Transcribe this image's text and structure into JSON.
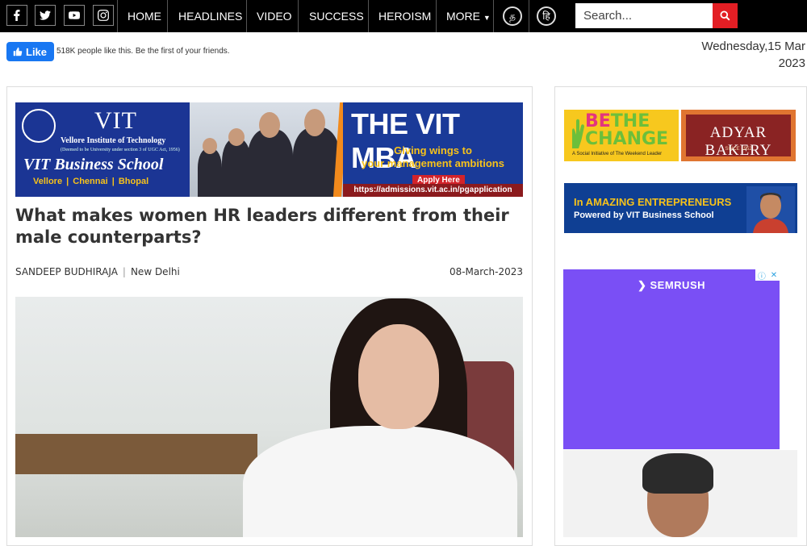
{
  "nav": {
    "social": [
      "facebook-icon",
      "twitter-icon",
      "youtube-icon",
      "instagram-icon"
    ],
    "items": [
      "HOME",
      "HEADLINES",
      "VIDEO",
      "SUCCESS",
      "HEROISM",
      "MORE"
    ],
    "lang_tamil": "த",
    "lang_hindi": "हि",
    "search_placeholder": "Search..."
  },
  "likebar": {
    "button": "Like",
    "text": "518K people like this. Be the first of your friends."
  },
  "date": {
    "line1": "Wednesday,15 Mar",
    "line2": "2023"
  },
  "banner": {
    "vit": "VIT",
    "institute": "Vellore Institute of Technology",
    "deemed": "(Deemed to be University under section 3 of UGC Act, 1956)",
    "school": "VIT Business School",
    "cities": "Vellore | Chennai | Bhopal",
    "mba": "THE VIT MBA",
    "tagline1": "Giving wings to",
    "tagline2": "your management ambitions",
    "apply": "Apply Here",
    "url": "https://admissions.vit.ac.in/pgapplication"
  },
  "article": {
    "title": "What makes women HR leaders different from their male counterparts?",
    "author": "SANDEEP BUDHIRAJA",
    "location": "New Delhi",
    "date": "08-March-2023"
  },
  "sidebar": {
    "btc_be": "BE",
    "btc_the": "THE",
    "btc_change": "CHANGE",
    "btc_sub": "A Social Initiative of The Weekend Leader",
    "adyar": "ADYAR BAKERY",
    "adyar_since": "SINCE 1952",
    "amazing_l1": "In AMAZING ENTREPRENEURS",
    "amazing_l2": "Powered by  VIT Business School",
    "semrush": "SEMRUSH"
  },
  "colors": {
    "nav_bg": "#000000",
    "search_button": "#e31e24",
    "like_button": "#1877f2",
    "semrush_bg": "#7a4ff5"
  }
}
